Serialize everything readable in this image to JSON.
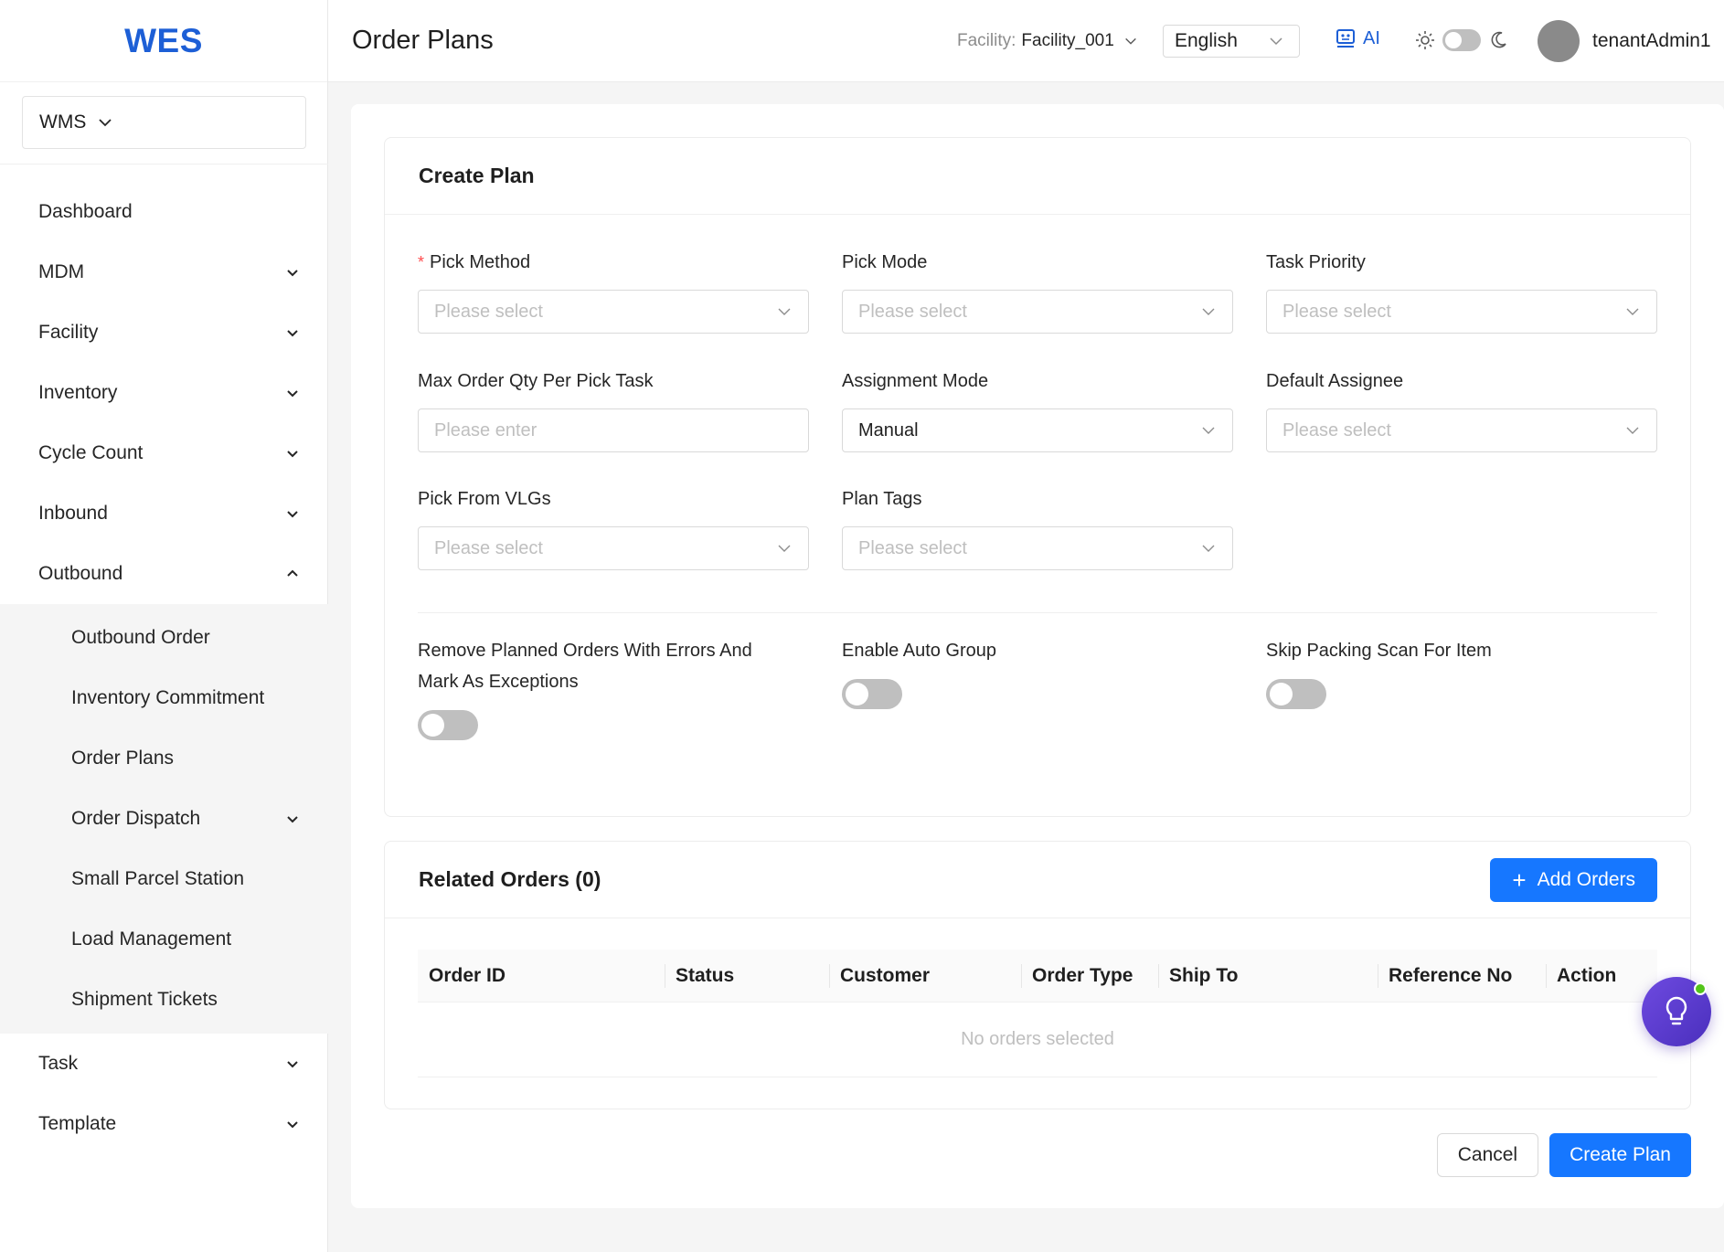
{
  "app": {
    "logo": "WES",
    "switcher": "WMS"
  },
  "sidebar": {
    "items": [
      {
        "label": "Dashboard"
      },
      {
        "label": "MDM"
      },
      {
        "label": "Facility"
      },
      {
        "label": "Inventory"
      },
      {
        "label": "Cycle Count"
      },
      {
        "label": "Inbound"
      },
      {
        "label": "Outbound"
      },
      {
        "label": "Task"
      },
      {
        "label": "Template"
      }
    ],
    "outbound_sub": [
      {
        "label": "Outbound Order"
      },
      {
        "label": "Inventory Commitment"
      },
      {
        "label": "Order Plans"
      },
      {
        "label": "Order Dispatch"
      },
      {
        "label": "Small Parcel Station"
      },
      {
        "label": "Load Management"
      },
      {
        "label": "Shipment Tickets"
      }
    ]
  },
  "header": {
    "title": "Order Plans",
    "facility_label": "Facility:",
    "facility_value": "Facility_001",
    "language": "English",
    "ai_label": "AI",
    "username": "tenantAdmin1"
  },
  "create_plan": {
    "title": "Create Plan",
    "fields": {
      "pick_method": {
        "label": "Pick Method",
        "placeholder": "Please select"
      },
      "pick_mode": {
        "label": "Pick Mode",
        "placeholder": "Please select"
      },
      "task_priority": {
        "label": "Task Priority",
        "placeholder": "Please select"
      },
      "max_order_qty": {
        "label": "Max Order Qty Per Pick Task",
        "placeholder": "Please enter"
      },
      "assignment_mode": {
        "label": "Assignment Mode",
        "value": "Manual"
      },
      "default_assignee": {
        "label": "Default Assignee",
        "placeholder": "Please select"
      },
      "pick_from_vlgs": {
        "label": "Pick From VLGs",
        "placeholder": "Please select"
      },
      "plan_tags": {
        "label": "Plan Tags",
        "placeholder": "Please select"
      }
    },
    "switches": {
      "remove_planned": {
        "label": "Remove Planned Orders With Errors And Mark As Exceptions",
        "on": false
      },
      "auto_group": {
        "label": "Enable Auto Group",
        "on": false
      },
      "skip_packing": {
        "label": "Skip Packing Scan For Item",
        "on": false
      }
    }
  },
  "related_orders": {
    "title": "Related Orders (0)",
    "add_button": "Add Orders",
    "columns": [
      "Order ID",
      "Status",
      "Customer",
      "Order Type",
      "Ship To",
      "Reference No",
      "Action"
    ],
    "empty_text": "No orders selected"
  },
  "footer": {
    "cancel": "Cancel",
    "submit": "Create Plan"
  },
  "colors": {
    "brand": "#1d5fd6",
    "primary": "#1677ff",
    "required": "#ff4d4f"
  }
}
